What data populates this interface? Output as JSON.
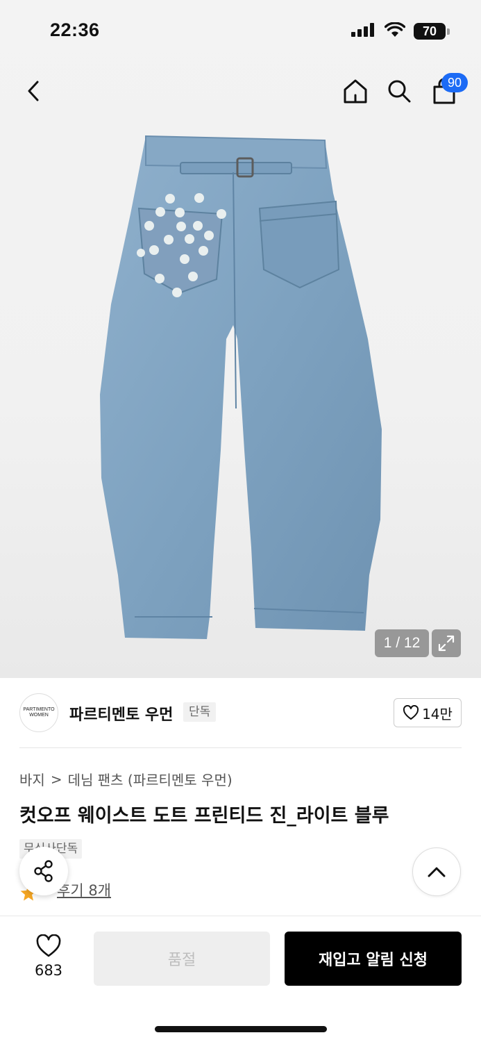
{
  "status_bar": {
    "time": "22:36",
    "battery": "70"
  },
  "header": {
    "cart_count": "90"
  },
  "gallery": {
    "counter": "1 / 12"
  },
  "brand": {
    "logo_line1": "PARTIMENTO",
    "logo_line2": "WOMEN",
    "name": "파르티멘토 우먼",
    "exclusive_badge": "단독",
    "likes": "14만"
  },
  "breadcrumb": {
    "category": "바지",
    "separator": ">",
    "subcategory": "데님 팬츠 (파르티멘토 우먼)"
  },
  "product": {
    "title": "컷오프 웨이스트 도트 프린티드 진_라이트 블루",
    "tag": "무신사단독",
    "reviews": "후기 8개"
  },
  "bottom_bar": {
    "wish_count": "683",
    "soldout_label": "품절",
    "restock_label": "재입고 알림 신청"
  },
  "colors": {
    "accent_blue": "#1c6bf5",
    "denim": "#7fa3c2",
    "rating_star": "#f5a623"
  },
  "icons": [
    "back-icon",
    "home-icon",
    "search-icon",
    "bag-icon",
    "expand-icon",
    "heart-icon",
    "share-icon",
    "chevron-up-icon",
    "star-icon"
  ]
}
